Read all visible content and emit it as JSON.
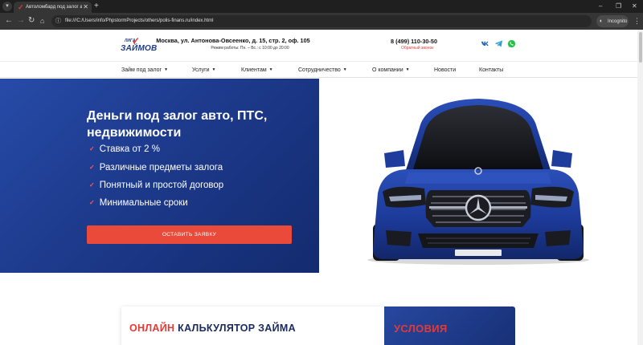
{
  "browser": {
    "tab_title": "Автоломбард под залог автомобиля",
    "address_url": "file:///C:/Users/info/PhpstormProjects/others/polis-finans.ru/index.html",
    "incognito_label": "Incognito"
  },
  "site": {
    "logo": {
      "top_text": "ЛИГА",
      "main_text": "ЗАЙМОВ"
    },
    "address": "Москва, ул. Антонова-Овсеенко, д. 15, стр. 2, оф. 105",
    "hours": "Режим работы: Пн. – Вс.: с 10:00 до 20:00",
    "phone": "8 (499) 110-30-50",
    "callback": "Обратный звонок",
    "social": [
      "vk-icon",
      "telegram-icon",
      "whatsapp-icon"
    ],
    "nav": [
      {
        "label": "Займ под залог",
        "has_dropdown": true
      },
      {
        "label": "Услуги",
        "has_dropdown": true
      },
      {
        "label": "Клиентам",
        "has_dropdown": true
      },
      {
        "label": "Сотрудничество",
        "has_dropdown": true
      },
      {
        "label": "О компании",
        "has_dropdown": true
      },
      {
        "label": "Новости",
        "has_dropdown": false
      },
      {
        "label": "Контакты",
        "has_dropdown": false
      }
    ]
  },
  "hero": {
    "title": "Деньги под залог авто, ПТС, недвижимости",
    "features": [
      "Ставка от 2 %",
      "Различные предметы залога",
      "Понятный и простой договор",
      "Минимальные сроки"
    ],
    "cta_label": "ОСТАВИТЬ ЗАЯВКУ"
  },
  "calculator": {
    "title_accent": "ОНЛАЙН",
    "title_rest": "КАЛЬКУЛЯТОР ЗАЙМА",
    "conditions_title": "УСЛОВИЯ"
  },
  "colors": {
    "brand_blue": "#1d3a8c",
    "accent_red": "#e53935",
    "cta_red": "#ea4a3a",
    "car_blue": "#1f3fa0"
  }
}
